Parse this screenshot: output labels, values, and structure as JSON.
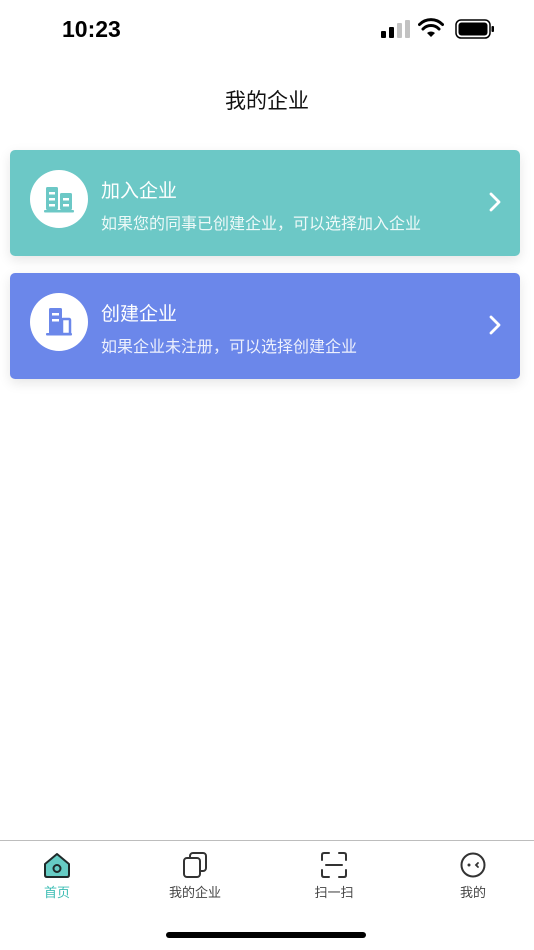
{
  "status": {
    "time": "10:23"
  },
  "page": {
    "title": "我的企业"
  },
  "cards": [
    {
      "title": "加入企业",
      "desc": "如果您的同事已创建企业，可以选择加入企业",
      "color": "#6cc8c6",
      "icon": "building-icon"
    },
    {
      "title": "创建企业",
      "desc": "如果企业未注册，可以选择创建企业",
      "color": "#6b87ea",
      "icon": "office-building-icon"
    }
  ],
  "tabs": [
    {
      "label": "首页",
      "icon": "home-icon",
      "active": true
    },
    {
      "label": "我的企业",
      "icon": "stacked-squares-icon",
      "active": false
    },
    {
      "label": "扫一扫",
      "icon": "scan-icon",
      "active": false
    },
    {
      "label": "我的",
      "icon": "profile-face-icon",
      "active": false
    }
  ],
  "colors": {
    "accent": "#3cbdb4",
    "join_card": "#6cc8c6",
    "create_card": "#6b87ea"
  }
}
